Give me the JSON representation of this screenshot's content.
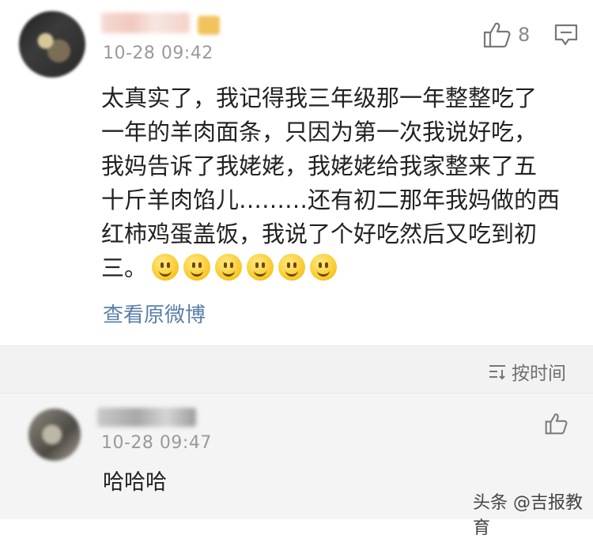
{
  "main_comment": {
    "time": "10-28 09:42",
    "like_count": "8",
    "lines": [
      "太真实了，我记得我三年级那一年整整吃了",
      "一年的羊肉面条，只因为第一次我说好吃，",
      "我妈告诉了我姥姥，我姥姥给我家整来了五",
      "十斤羊肉馅儿………还有初二那年我妈做的西",
      "红柿鸡蛋盖饭，我说了个好吃然后又吃到初",
      "三。"
    ],
    "emoji_count": 6,
    "emoji_name": "smile-emoji",
    "view_original": "查看原微博"
  },
  "sort": {
    "label": "按时间"
  },
  "reply": {
    "time": "10-28 09:47",
    "text": "哈哈哈"
  },
  "watermark": "头条 @吉报教育"
}
